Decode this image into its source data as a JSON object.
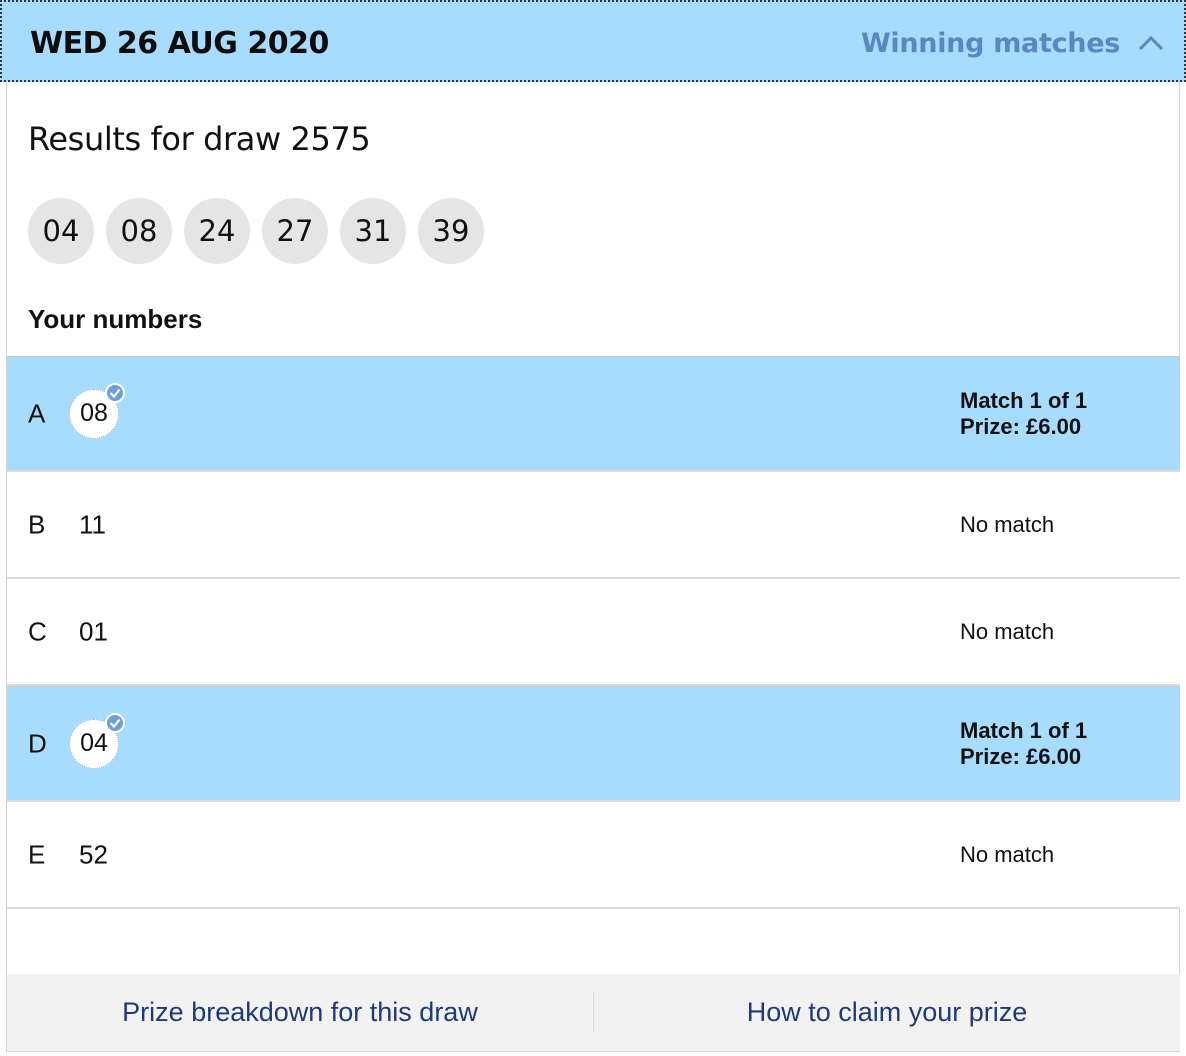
{
  "header": {
    "date": "WED 26 AUG 2020",
    "toggle_label": "Winning matches"
  },
  "results": {
    "title": "Results for draw 2575",
    "balls": [
      "04",
      "08",
      "24",
      "27",
      "31",
      "39"
    ]
  },
  "your_numbers": {
    "heading": "Your numbers",
    "lines": [
      {
        "letter": "A",
        "number": "08",
        "matched": true,
        "match_text": "Match 1 of 1",
        "prize_text": "Prize: £6.00"
      },
      {
        "letter": "B",
        "number": "11",
        "matched": false,
        "result_text": "No match"
      },
      {
        "letter": "C",
        "number": "01",
        "matched": false,
        "result_text": "No match"
      },
      {
        "letter": "D",
        "number": "04",
        "matched": true,
        "match_text": "Match 1 of 1",
        "prize_text": "Prize: £6.00"
      },
      {
        "letter": "E",
        "number": "52",
        "matched": false,
        "result_text": "No match"
      }
    ]
  },
  "footer": {
    "prize_breakdown_label": "Prize breakdown for this draw",
    "claim_label": "How to claim your prize"
  },
  "colors": {
    "header_bg": "#a8dcff",
    "winning_row_bg": "#a8dcff",
    "link_blue": "#1e3a78",
    "toggle_blue": "#5b86c0"
  },
  "icons": {
    "toggle": "chevron-up-icon",
    "match": "check-circle-icon"
  }
}
